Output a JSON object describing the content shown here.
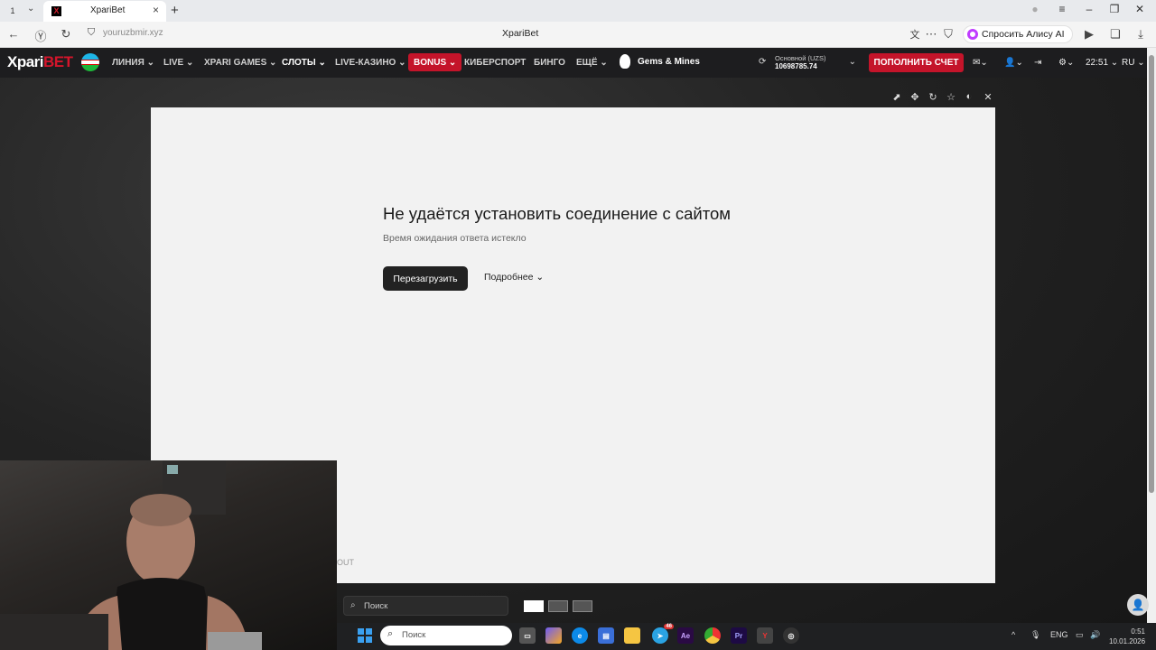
{
  "browser": {
    "tab_count": "1",
    "tab_title": "XpariBet",
    "url": "youruzbmir.xyz",
    "page_title": "XpariBet",
    "alice_label": "Спросить Алису AI"
  },
  "site": {
    "logo_main": "Xpari",
    "logo_accent": "BET",
    "menu": [
      "ЛИНИЯ",
      "LIVE",
      "XPARI GAMES",
      "СЛОТЫ",
      "LIVE-КАЗИНО"
    ],
    "bonus": "BONUS",
    "menu2": [
      "КИБЕРСПОРТ",
      "БИНГО",
      "ЕЩЁ"
    ],
    "gems": "Gems & Mines",
    "account_label": "Основной (UZS)",
    "account_balance": "10698785.74",
    "deposit": "ПОПОЛНИТЬ СЧЕТ",
    "time": "22:51",
    "lang": "RU"
  },
  "error_page": {
    "title": "Не удаётся установить соединение с сайтом",
    "subtitle": "Время ожидания ответа истекло",
    "reload": "Перезагрузить",
    "details": "Подробнее"
  },
  "game": {
    "partial_text": "OUT",
    "search_placeholder": "Поиск"
  },
  "taskbar": {
    "search_placeholder": "Поиск",
    "lang": "ENG",
    "time": "0:51",
    "date": "10.01.2026",
    "telegram_badge": "46"
  }
}
